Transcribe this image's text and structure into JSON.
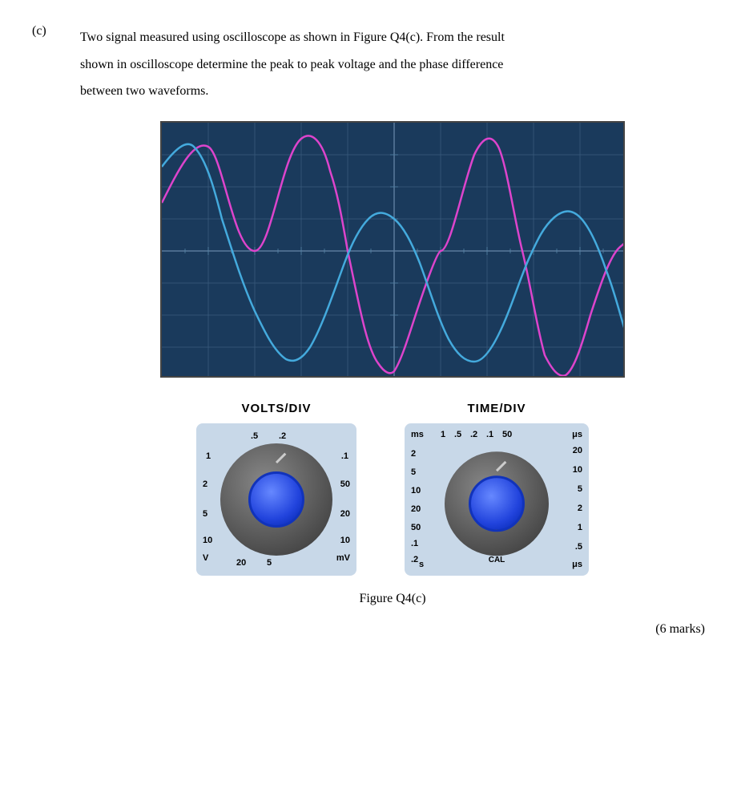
{
  "question": {
    "part_label": "(c)",
    "text_line1": "Two signal measured using oscilloscope as shown in Figure Q4(c). From the result",
    "text_line2": "shown in oscilloscope determine the peak to peak voltage and the phase difference",
    "text_line3": "between two waveforms.",
    "figure_caption": "Figure Q4(c)",
    "marks": "(6 marks)"
  },
  "controls": {
    "volts_div": {
      "title": "VOLTS/DIV",
      "labels": [
        {
          "text": ".5",
          "pos": "top-center-left"
        },
        {
          "text": ".2",
          "pos": "top-center-right"
        },
        {
          "text": "1",
          "pos": "left-top"
        },
        {
          "text": ".1",
          "pos": "right-top"
        },
        {
          "text": "2",
          "pos": "left-mid"
        },
        {
          "text": "50",
          "pos": "right-mid"
        },
        {
          "text": "5",
          "pos": "left-bot"
        },
        {
          "text": "20",
          "pos": "right-bot"
        },
        {
          "text": "10",
          "pos": "bot-left2"
        },
        {
          "text": "10",
          "pos": "bot-right"
        },
        {
          "text": "V",
          "pos": "bot-far-left"
        },
        {
          "text": "20",
          "pos": "bot-center"
        },
        {
          "text": "5",
          "pos": "bot-center2"
        },
        {
          "text": "mV",
          "pos": "bot-far-right"
        }
      ]
    },
    "time_div": {
      "title": "TIME/DIV",
      "labels": [
        {
          "text": "ms",
          "pos": "top-left"
        },
        {
          "text": "1",
          "pos": "top-center-l"
        },
        {
          "text": ".5",
          "pos": "top-center"
        },
        {
          "text": ".2",
          "pos": "top-center-r"
        },
        {
          "text": ".1",
          "pos": "top-r"
        },
        {
          "text": "50",
          "pos": "top-far-r"
        },
        {
          "text": "μs",
          "pos": "top-far-right"
        },
        {
          "text": "2",
          "pos": "left-top2"
        },
        {
          "text": "5",
          "pos": "left-mid1"
        },
        {
          "text": "10",
          "pos": "left-mid2"
        },
        {
          "text": "20",
          "pos": "left-mid3"
        },
        {
          "text": "50",
          "pos": "left-bot1"
        },
        {
          "text": ".1",
          "pos": "left-bot2"
        },
        {
          "text": ".2",
          "pos": "left-far-bot"
        },
        {
          "text": "s",
          "pos": "bot-left"
        },
        {
          "text": "μs",
          "pos": "bot-right"
        },
        {
          "text": "20",
          "pos": "right-top"
        },
        {
          "text": "10",
          "pos": "right-mid1"
        },
        {
          "text": "5",
          "pos": "right-mid2"
        },
        {
          "text": "2",
          "pos": "right-mid3"
        },
        {
          "text": "1",
          "pos": "right-mid4"
        },
        {
          "text": ".5",
          "pos": "right-bot"
        },
        {
          "text": "CAL",
          "pos": "cal"
        }
      ]
    }
  },
  "waveforms": {
    "pink": {
      "color": "#dd44cc",
      "description": "pink sinusoidal wave"
    },
    "blue": {
      "color": "#44aadd",
      "description": "blue sinusoidal wave, slightly phase shifted"
    }
  }
}
